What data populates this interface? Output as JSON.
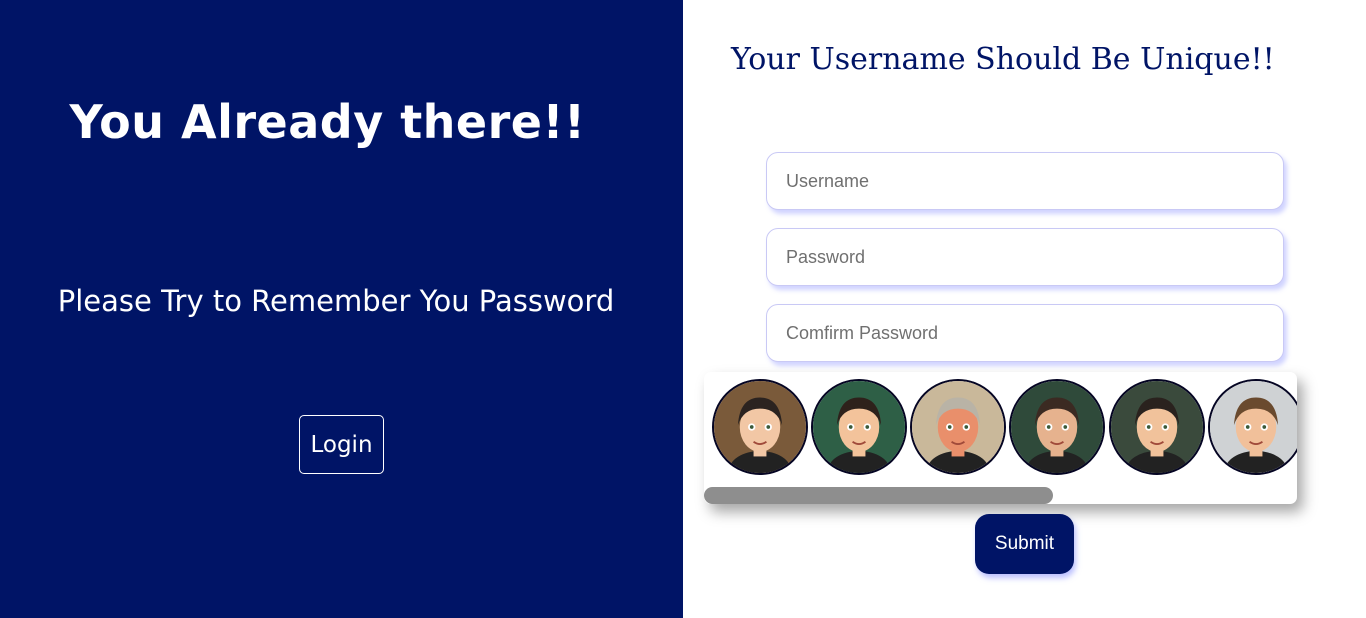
{
  "left": {
    "title": "You Already there!!",
    "subtitle": "Please Try to Remember You Password",
    "login_label": "Login"
  },
  "form": {
    "title": "Your Username Should Be Unique!!",
    "username_placeholder": "Username",
    "password_placeholder": "Password",
    "confirm_placeholder": "Comfirm Password",
    "submit_label": "Submit"
  },
  "avatars": [
    {
      "name": "avatar-1",
      "bg": "#7a5a3a",
      "skin": "#f2c7a5",
      "hair": "#2b2320"
    },
    {
      "name": "avatar-2",
      "bg": "#2e5f46",
      "skin": "#f3c39b",
      "hair": "#2e211b"
    },
    {
      "name": "avatar-3",
      "bg": "#c9b89a",
      "skin": "#e98f6b",
      "hair": "#b9b3a6"
    },
    {
      "name": "avatar-4",
      "bg": "#2f4a3a",
      "skin": "#e6b28e",
      "hair": "#3b2a22"
    },
    {
      "name": "avatar-5",
      "bg": "#3a4a3c",
      "skin": "#f1c29b",
      "hair": "#2a221e"
    },
    {
      "name": "avatar-6",
      "bg": "#cfd2d4",
      "skin": "#f1c09a",
      "hair": "#6a4a2e"
    }
  ],
  "colors": {
    "brand": "#001466",
    "scroll_thumb": "#8e8e8e"
  }
}
